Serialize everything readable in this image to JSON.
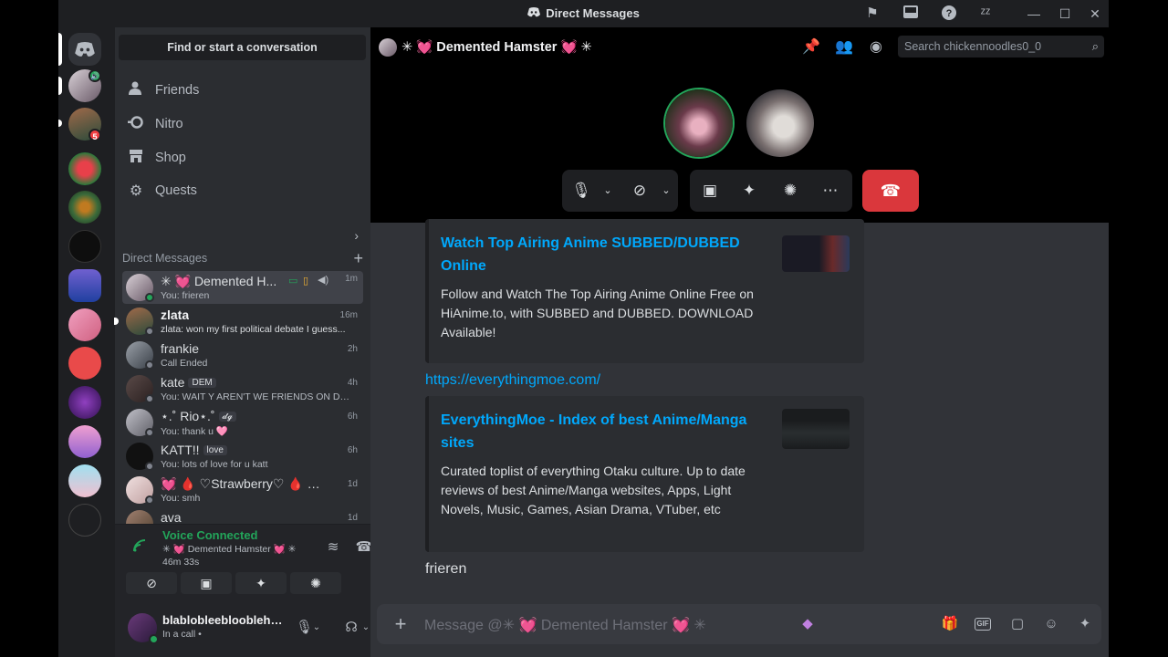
{
  "titlebar": {
    "title": "Direct Messages"
  },
  "sidebar": {
    "finder_label": "Find or start a conversation",
    "nav": [
      {
        "label": "Friends",
        "icon": "friends-icon"
      },
      {
        "label": "Nitro",
        "icon": "nitro-icon"
      },
      {
        "label": "Shop",
        "icon": "shop-icon"
      },
      {
        "label": "Quests",
        "icon": "quests-icon"
      }
    ],
    "dm_header": "Direct Messages",
    "dms": [
      {
        "name": "✳ 💓 Demented H...",
        "sub": "You: frieren",
        "time": "1m"
      },
      {
        "name": "zlata",
        "sub": "zlata: won my first political debate I guess...",
        "time": "16m"
      },
      {
        "name": "frankie",
        "sub": "Call Ended",
        "time": "2h"
      },
      {
        "name": "kate",
        "tag": "DEM",
        "sub": "You: WAIT Y AREN'T WE FRIENDS ON DIS...",
        "time": "4h"
      },
      {
        "name": "⋆.˚ Rio⋆.˚",
        "tag": "𝓭𝓰",
        "sub": "You: thank u 🩷",
        "time": "6h"
      },
      {
        "name": "KATT!!",
        "tag": "love",
        "sub": "You: lots of love for u katt",
        "time": "6h"
      },
      {
        "name": "💓 🩸 ♡Strawberry♡ 🩸 💓...",
        "sub": "You: smh",
        "time": "1d"
      },
      {
        "name": "ava",
        "sub": "",
        "time": "1d"
      }
    ],
    "server_badge": "5",
    "voice": {
      "title": "Voice Connected",
      "channel": "✳ 💓 Demented Hamster 💓 ✳",
      "elapsed": "46m 33s"
    },
    "user": {
      "name": "blablobleeblooblehu...",
      "status": "In a call •"
    }
  },
  "main": {
    "channel_title": "✳ 💓 Demented Hamster 💓 ✳",
    "search_placeholder": "Search chickennoodles0_0",
    "embeds": [
      {
        "title": "Watch Top Airing Anime SUBBED/DUBBED Online",
        "desc": "Follow and Watch The Top Airing Anime Online Free on HiAnime.to, with SUBBED and DUBBED. DOWNLOAD Available!"
      },
      {
        "title": "EverythingMoe - Index of best Anime/Manga sites",
        "desc": "Curated toplist of everything Otaku culture. Up to date reviews of best Anime/Manga websites, Apps, Light Novels, Music, Games, Asian Drama, VTuber, etc"
      }
    ],
    "link": "https://everythingmoe.com/",
    "message": "frieren",
    "composer_placeholder": "Message @✳ 💓 Demented Hamster 💓 ✳"
  },
  "colors": {
    "accent": "#5865f2",
    "link": "#00a8fc",
    "online": "#23a55a",
    "danger": "#da373c"
  }
}
